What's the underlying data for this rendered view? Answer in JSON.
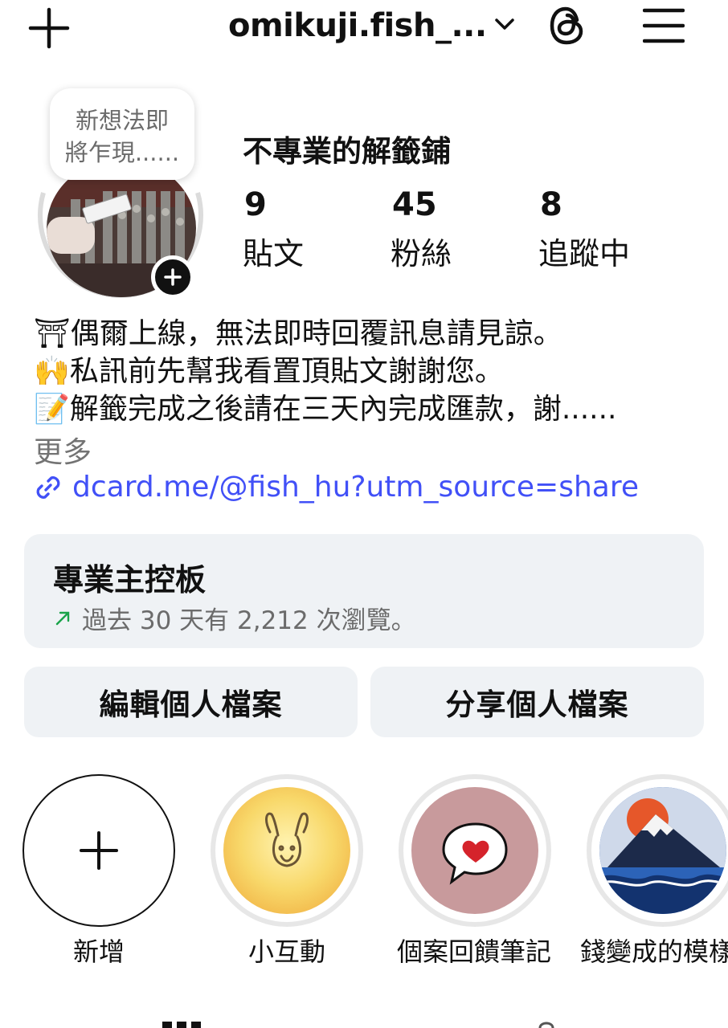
{
  "topbar": {
    "username": "omikuji.fish_...",
    "add_icon": "plus-icon",
    "dropdown_icon": "chevron-down-icon",
    "threads_icon": "threads-icon",
    "menu_icon": "hamburger-menu-icon"
  },
  "profile": {
    "note_line1": "新想法即",
    "note_line2": "將乍現......",
    "display_name": "不專業的解籤鋪",
    "stats": [
      {
        "value": "9",
        "label": "貼文"
      },
      {
        "value": "45",
        "label": "粉絲"
      },
      {
        "value": "8",
        "label": "追蹤中"
      }
    ],
    "bio_lines": [
      "⛩偶爾上線，無法即時回覆訊息請見諒。",
      "🙌私訊前先幫我看置頂貼文謝謝您。",
      "📝解籤完成之後請在三天內完成匯款，謝......"
    ],
    "more_label": "更多",
    "link": "dcard.me/@fish_hu?utm_source=share"
  },
  "dashboard": {
    "title": "專業主控板",
    "subtitle": "過去 30 天有 2,212 次瀏覽。"
  },
  "buttons": {
    "edit_profile": "編輯個人檔案",
    "share_profile": "分享個人檔案"
  },
  "highlights": [
    {
      "label": "新增"
    },
    {
      "label": "小互動"
    },
    {
      "label": "個案回饋筆記"
    },
    {
      "label": "錢變成的模樣"
    }
  ],
  "colors": {
    "link": "#4150f7",
    "panel_bg": "#eff2f5",
    "trend_green": "#1aa34a"
  }
}
